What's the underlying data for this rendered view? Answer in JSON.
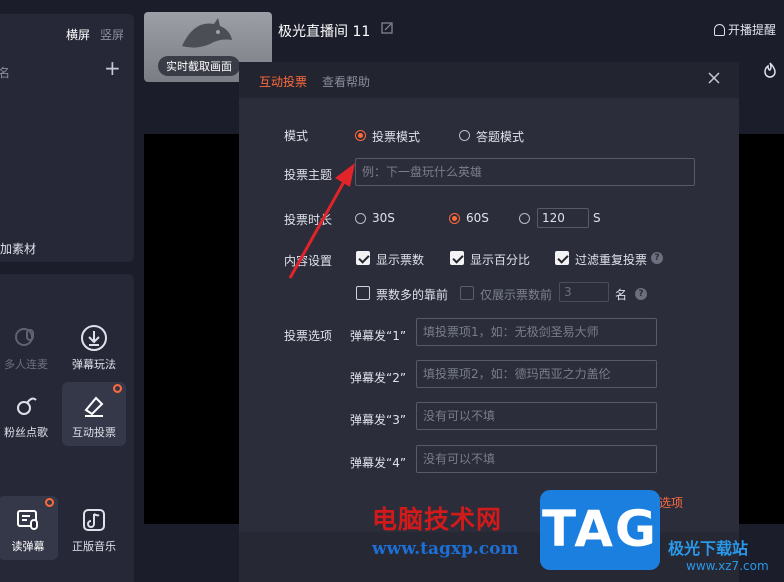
{
  "left_panel": {
    "orientation_tabs": [
      "横屏",
      "竖屏"
    ],
    "partial_label_top": "名",
    "add_material_label": "加素材",
    "tools": [
      {
        "label": "多人连麦",
        "icon": "multi-mic-icon",
        "dim": true
      },
      {
        "label": "弹幕玩法",
        "icon": "download-circle-icon",
        "dim": false
      },
      {
        "label": "粉丝点歌",
        "icon": "music-note-icon",
        "dim": false
      },
      {
        "label": "互动投票",
        "icon": "vote-eraser-icon",
        "dim": false,
        "active": true
      },
      {
        "label": "读弹幕",
        "icon": "read-danmaku-icon",
        "dim": false,
        "active": true
      },
      {
        "label": "正版音乐",
        "icon": "music-app-icon",
        "dim": false
      }
    ]
  },
  "top": {
    "thumbnail_button": "实时截取画面",
    "room_title": "极光直播间 11",
    "notify_label": "开播提醒"
  },
  "dialog": {
    "tabs": [
      "互动投票",
      "查看帮助"
    ],
    "mode": {
      "label": "模式",
      "options": [
        "投票模式",
        "答题模式"
      ],
      "selected": "投票模式"
    },
    "topic": {
      "label": "投票主题",
      "placeholder": "例：下一盘玩什么英雄"
    },
    "duration": {
      "label": "投票时长",
      "options": [
        "30S",
        "60S"
      ],
      "selected": "60S",
      "custom_value": "120",
      "custom_unit": "S"
    },
    "content": {
      "label": "内容设置",
      "show_votes": "显示票数",
      "show_percent": "显示百分比",
      "filter_repeat": "过滤重复投票",
      "more_votes_first": "票数多的靠前",
      "show_top_only": "仅展示票数前",
      "top_n": "3",
      "rank_suffix": "名"
    },
    "options": {
      "label": "投票选项",
      "items": [
        {
          "prefix": "弹幕发“1”",
          "placeholder": "填投票项1，如：无极剑圣易大师"
        },
        {
          "prefix": "弹幕发“2”",
          "placeholder": "填投票项2，如：德玛西亚之力盖伦"
        },
        {
          "prefix": "弹幕发“3”",
          "placeholder": "没有可以不填"
        },
        {
          "prefix": "弹幕发“4”",
          "placeholder": "没有可以不填"
        }
      ],
      "add_label": "选项"
    }
  },
  "watermark": {
    "site_name": "电脑技术网",
    "site_url": "www.tagxp.com",
    "badge": "TAG",
    "logo_text": "极光下载站",
    "logo_url": "www.xz7.com"
  },
  "colors": {
    "accent": "#ff6a3d",
    "arrow": "#e0242a",
    "dialog_bg": "#2b2d3a"
  }
}
